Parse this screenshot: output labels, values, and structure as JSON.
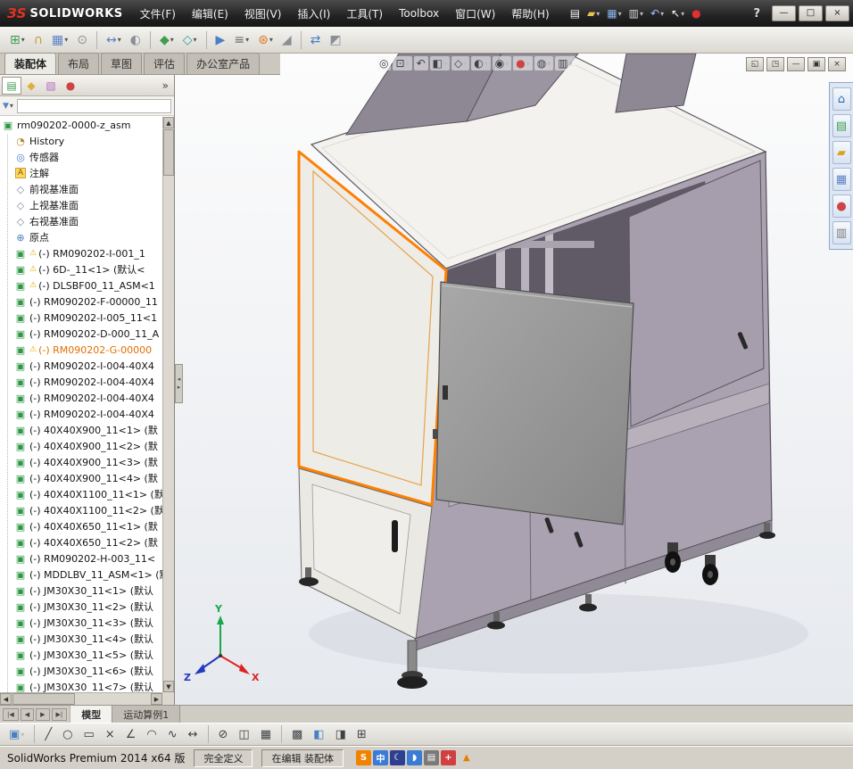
{
  "colors": {
    "selection_orange": "#ff7f00",
    "panel_purple": "#aaa2b0",
    "panel_white": "#f3f2ee",
    "door_gray": "#9a9a9a"
  },
  "titlebar": {
    "logo_mark": "ЗS",
    "logo_text": "SOLIDWORKS",
    "menus": [
      "文件(F)",
      "编辑(E)",
      "视图(V)",
      "插入(I)",
      "工具(T)",
      "Toolbox",
      "窗口(W)",
      "帮助(H)"
    ],
    "quick_icons": [
      {
        "name": "new-document-icon",
        "glyph": "▤",
        "color": "#f5f5f5"
      },
      {
        "name": "open-icon",
        "glyph": "▰",
        "color": "#eac24e",
        "dropdown": true
      },
      {
        "name": "save-icon",
        "glyph": "▦",
        "color": "#8ab4f0",
        "dropdown": true
      },
      {
        "name": "print-icon",
        "glyph": "▥",
        "color": "#d8d8d8",
        "dropdown": true
      },
      {
        "name": "undo-icon",
        "glyph": "↶",
        "color": "#9cc2ff",
        "dropdown": true
      },
      {
        "name": "select-icon",
        "glyph": "↖",
        "color": "#ffffff",
        "dropdown": true
      },
      {
        "name": "record-icon",
        "glyph": "●",
        "color": "#e03030"
      }
    ],
    "help_glyph": "?",
    "window_buttons": [
      {
        "name": "minimize-button",
        "glyph": "—"
      },
      {
        "name": "maximize-button",
        "glyph": "□"
      },
      {
        "name": "close-button",
        "glyph": "×"
      }
    ]
  },
  "assembly_toolbar": {
    "icons": [
      {
        "name": "insert-components-icon",
        "glyph": "⊞",
        "color": "#3f9d4e",
        "dropdown": true
      },
      {
        "name": "mate-icon",
        "glyph": "∩",
        "color": "#c89b3c"
      },
      {
        "name": "linear-component-pattern-icon",
        "glyph": "▦",
        "color": "#5b84c4",
        "dropdown": true
      },
      {
        "name": "smart-fasteners-icon",
        "glyph": "⊙",
        "color": "#8a8f96"
      },
      {
        "sep": true
      },
      {
        "name": "move-component-icon",
        "glyph": "↔",
        "color": "#5b84c4",
        "dropdown": true
      },
      {
        "name": "show-hidden-components-icon",
        "glyph": "◐",
        "color": "#8a8f96"
      },
      {
        "sep": true
      },
      {
        "name": "assembly-features-icon",
        "glyph": "◆",
        "color": "#3f9d4e",
        "dropdown": true
      },
      {
        "name": "reference-geometry-icon",
        "glyph": "◇",
        "color": "#2e9a9a",
        "dropdown": true
      },
      {
        "sep": true
      },
      {
        "name": "new-motion-study-icon",
        "glyph": "▶",
        "color": "#4a7fc1"
      },
      {
        "name": "bill-of-materials-icon",
        "glyph": "≡",
        "color": "#6a6f76",
        "dropdown": true
      },
      {
        "name": "exploded-view-icon",
        "glyph": "⊛",
        "color": "#e07820",
        "dropdown": true
      },
      {
        "name": "instant3d-icon",
        "glyph": "◢",
        "color": "#8a8f96"
      },
      {
        "sep": true
      },
      {
        "name": "external-references-icon",
        "glyph": "⇄",
        "color": "#4a7fc1"
      },
      {
        "name": "large-assembly-mode-icon",
        "glyph": "◩",
        "color": "#8a8f96"
      }
    ]
  },
  "command_tabs": {
    "tabs": [
      {
        "label": "装配体",
        "active": true
      },
      {
        "label": "布局",
        "active": false
      },
      {
        "label": "草图",
        "active": false
      },
      {
        "label": "评估",
        "active": false
      },
      {
        "label": "办公室产品",
        "active": false
      }
    ]
  },
  "headsup": {
    "icons": [
      {
        "name": "zoom-fit-icon",
        "glyph": "◎"
      },
      {
        "name": "zoom-area-icon",
        "glyph": "⊡",
        "dropdown": true
      },
      {
        "name": "previous-view-icon",
        "glyph": "↶"
      },
      {
        "name": "section-view-icon",
        "glyph": "◧",
        "dropdown": true
      },
      {
        "name": "view-orientation-icon",
        "glyph": "◇",
        "dropdown": true
      },
      {
        "name": "display-style-icon",
        "glyph": "◐",
        "dropdown": true
      },
      {
        "name": "hide-show-items-icon",
        "glyph": "◉",
        "dropdown": true
      },
      {
        "name": "edit-appearance-icon",
        "glyph": "●",
        "color": "#cc4444",
        "dropdown": true
      },
      {
        "name": "apply-scene-icon",
        "glyph": "◍",
        "dropdown": true
      },
      {
        "name": "view-settings-icon",
        "glyph": "▥",
        "dropdown": true
      }
    ]
  },
  "doc_buttons": [
    {
      "name": "doc-cascade-button",
      "glyph": "◱"
    },
    {
      "name": "doc-tile-button",
      "glyph": "◳"
    },
    {
      "name": "doc-minimize-button",
      "glyph": "—"
    },
    {
      "name": "doc-restore-button",
      "glyph": "▣"
    },
    {
      "name": "doc-close-button",
      "glyph": "×"
    }
  ],
  "feature_panel": {
    "header_tabs": [
      {
        "name": "featuremanager-tree-tab",
        "glyph": "▤",
        "color": "#3f9d4e",
        "active": true
      },
      {
        "name": "propertymanager-tab",
        "glyph": "◆",
        "color": "#d9b13b"
      },
      {
        "name": "configuration-manager-tab",
        "glyph": "▧",
        "color": "#b06fc0"
      },
      {
        "name": "appearances-manager-tab",
        "glyph": "●",
        "color": "#cc4444"
      }
    ],
    "overflow_glyph": "»",
    "filter": {
      "funnel_glyph": "▼",
      "dropdown_glyph": "▾"
    }
  },
  "feature_tree": {
    "root_label": "rm090202-0000-z_asm",
    "warning_glyph": "⚠",
    "icon_glyphs": {
      "assembly_root": "▣",
      "history": "◔",
      "sensors": "◎",
      "annotations": "A",
      "plane": "◇",
      "origin": "⊕",
      "component": "▣"
    },
    "items": [
      {
        "label": "History",
        "icon": "history"
      },
      {
        "label": "传感器",
        "icon": "sensors"
      },
      {
        "label": "注解",
        "icon": "annotations"
      },
      {
        "label": "前视基准面",
        "icon": "plane"
      },
      {
        "label": "上视基准面",
        "icon": "plane"
      },
      {
        "label": "右视基准面",
        "icon": "plane"
      },
      {
        "label": "原点",
        "icon": "origin"
      },
      {
        "label": "(-) RM090202-I-001_1",
        "icon": "component",
        "warning": true
      },
      {
        "label": "(-) 6D-_11<1> (默认<",
        "icon": "component",
        "warning": true
      },
      {
        "label": "(-) DLSBF00_11_ASM<1",
        "icon": "component",
        "warning": true
      },
      {
        "label": "(-) RM090202-F-00000_11",
        "icon": "component"
      },
      {
        "label": "(-) RM090202-I-005_11<1",
        "icon": "component"
      },
      {
        "label": "(-) RM090202-D-000_11_A",
        "icon": "component"
      },
      {
        "label": "(-) RM090202-G-00000",
        "icon": "component",
        "warning": true,
        "selected": true
      },
      {
        "label": "(-) RM090202-I-004-40X4",
        "icon": "component"
      },
      {
        "label": "(-) RM090202-I-004-40X4",
        "icon": "component"
      },
      {
        "label": "(-) RM090202-I-004-40X4",
        "icon": "component"
      },
      {
        "label": "(-) RM090202-I-004-40X4",
        "icon": "component"
      },
      {
        "label": "(-) 40X40X900_11<1> (默",
        "icon": "component"
      },
      {
        "label": "(-) 40X40X900_11<2> (默",
        "icon": "component"
      },
      {
        "label": "(-) 40X40X900_11<3> (默",
        "icon": "component"
      },
      {
        "label": "(-) 40X40X900_11<4> (默",
        "icon": "component"
      },
      {
        "label": "(-) 40X40X1100_11<1> (默",
        "icon": "component"
      },
      {
        "label": "(-) 40X40X1100_11<2> (默",
        "icon": "component"
      },
      {
        "label": "(-) 40X40X650_11<1> (默",
        "icon": "component"
      },
      {
        "label": "(-) 40X40X650_11<2> (默",
        "icon": "component"
      },
      {
        "label": "(-) RM090202-H-003_11<",
        "icon": "component"
      },
      {
        "label": "(-) MDDLBV_11_ASM<1> (默",
        "icon": "component"
      },
      {
        "label": "(-) JM30X30_11<1> (默认",
        "icon": "component"
      },
      {
        "label": "(-) JM30X30_11<2> (默认",
        "icon": "component"
      },
      {
        "label": "(-) JM30X30_11<3> (默认",
        "icon": "component"
      },
      {
        "label": "(-) JM30X30_11<4> (默认",
        "icon": "component"
      },
      {
        "label": "(-) JM30X30_11<5> (默认",
        "icon": "component"
      },
      {
        "label": "(-) JM30X30_11<6> (默认",
        "icon": "component"
      },
      {
        "label": "(-) JM30X30_11<7> (默认",
        "icon": "component"
      }
    ]
  },
  "scrollbar": {
    "up": "▲",
    "down": "▼",
    "left": "◀",
    "right": "▶"
  },
  "splitter": {
    "left_glyph": "◂",
    "right_glyph": "▸"
  },
  "taskpane": {
    "icons": [
      {
        "name": "solidworks-resources-icon",
        "glyph": "⌂",
        "color": "#2b6cb5"
      },
      {
        "name": "design-library-icon",
        "glyph": "▤",
        "color": "#3f9d4e"
      },
      {
        "name": "file-explorer-icon",
        "glyph": "▰",
        "color": "#d9a520"
      },
      {
        "name": "view-palette-icon",
        "glyph": "▦",
        "color": "#5b84c4"
      },
      {
        "name": "appearances-icon",
        "glyph": "●",
        "color": "#cc4444"
      },
      {
        "name": "custom-properties-icon",
        "glyph": "▥",
        "color": "#7a7a7a"
      }
    ]
  },
  "model_tabs": {
    "nav": [
      "|◀",
      "◀",
      "▶",
      "▶|"
    ],
    "tabs": [
      {
        "label": "模型",
        "active": true
      },
      {
        "label": "运动算例1",
        "active": false
      }
    ]
  },
  "sketch_toolbar": {
    "icons": [
      {
        "name": "save-icon",
        "glyph": "▣",
        "color": "#4a7fc1",
        "dropdown": true
      },
      {
        "sep": true
      },
      {
        "name": "line-icon",
        "glyph": "╱",
        "color": "#3c4148"
      },
      {
        "name": "circle-icon",
        "glyph": "○",
        "color": "#3c4148"
      },
      {
        "name": "rectangle-icon",
        "glyph": "▭",
        "color": "#3c4148"
      },
      {
        "name": "point-icon",
        "glyph": "×",
        "color": "#3c4148"
      },
      {
        "name": "angle-icon",
        "glyph": "∠",
        "color": "#3c4148"
      },
      {
        "name": "arc-icon",
        "glyph": "◠",
        "color": "#3c4148"
      },
      {
        "name": "spline-icon",
        "glyph": "∿",
        "color": "#3c4148"
      },
      {
        "name": "dimension-icon",
        "glyph": "↔",
        "color": "#3c4148"
      },
      {
        "sep": true
      },
      {
        "name": "trim-icon",
        "glyph": "⊘",
        "color": "#3c4148"
      },
      {
        "name": "mirror-icon",
        "glyph": "◫",
        "color": "#3c4148"
      },
      {
        "name": "pattern-icon",
        "glyph": "▦",
        "color": "#3c4148"
      },
      {
        "sep": true
      },
      {
        "name": "grid-icon",
        "glyph": "▩",
        "color": "#3c4148"
      },
      {
        "name": "view-cube-icon",
        "glyph": "◧",
        "color": "#4a7fc1"
      },
      {
        "name": "section-icon",
        "glyph": "◨",
        "color": "#3c4148"
      },
      {
        "name": "evaluate-icon",
        "glyph": "⊞",
        "color": "#3c4148"
      }
    ]
  },
  "statusbar": {
    "app_text": "SolidWorks Premium 2014 x64 版",
    "define_state": "完全定义",
    "edit_state": "在编辑 装配体",
    "tray": [
      {
        "name": "sogou-input-icon",
        "glyph": "S",
        "bg": "#f08300",
        "fg": "#ffffff"
      },
      {
        "name": "chinese-mode-icon",
        "glyph": "中",
        "bg": "#3a7bd5",
        "fg": "#ffffff"
      },
      {
        "name": "moon-icon",
        "glyph": "☾",
        "bg": "#2d3f8e",
        "fg": "#ffffff"
      },
      {
        "name": "halfwidth-icon",
        "glyph": "◗",
        "bg": "#3a7bd5",
        "fg": "#ffffff"
      },
      {
        "name": "keyboard-icon",
        "glyph": "▤",
        "bg": "#7a7a7a",
        "fg": "#ffffff"
      },
      {
        "name": "toolbox-tray-icon",
        "glyph": "+",
        "bg": "#d04040",
        "fg": "#ffffff"
      }
    ],
    "tray_arrow_glyph": "▲"
  },
  "viewport": {
    "triad": {
      "x_label": "X",
      "y_label": "Y",
      "z_label": "Z"
    }
  }
}
